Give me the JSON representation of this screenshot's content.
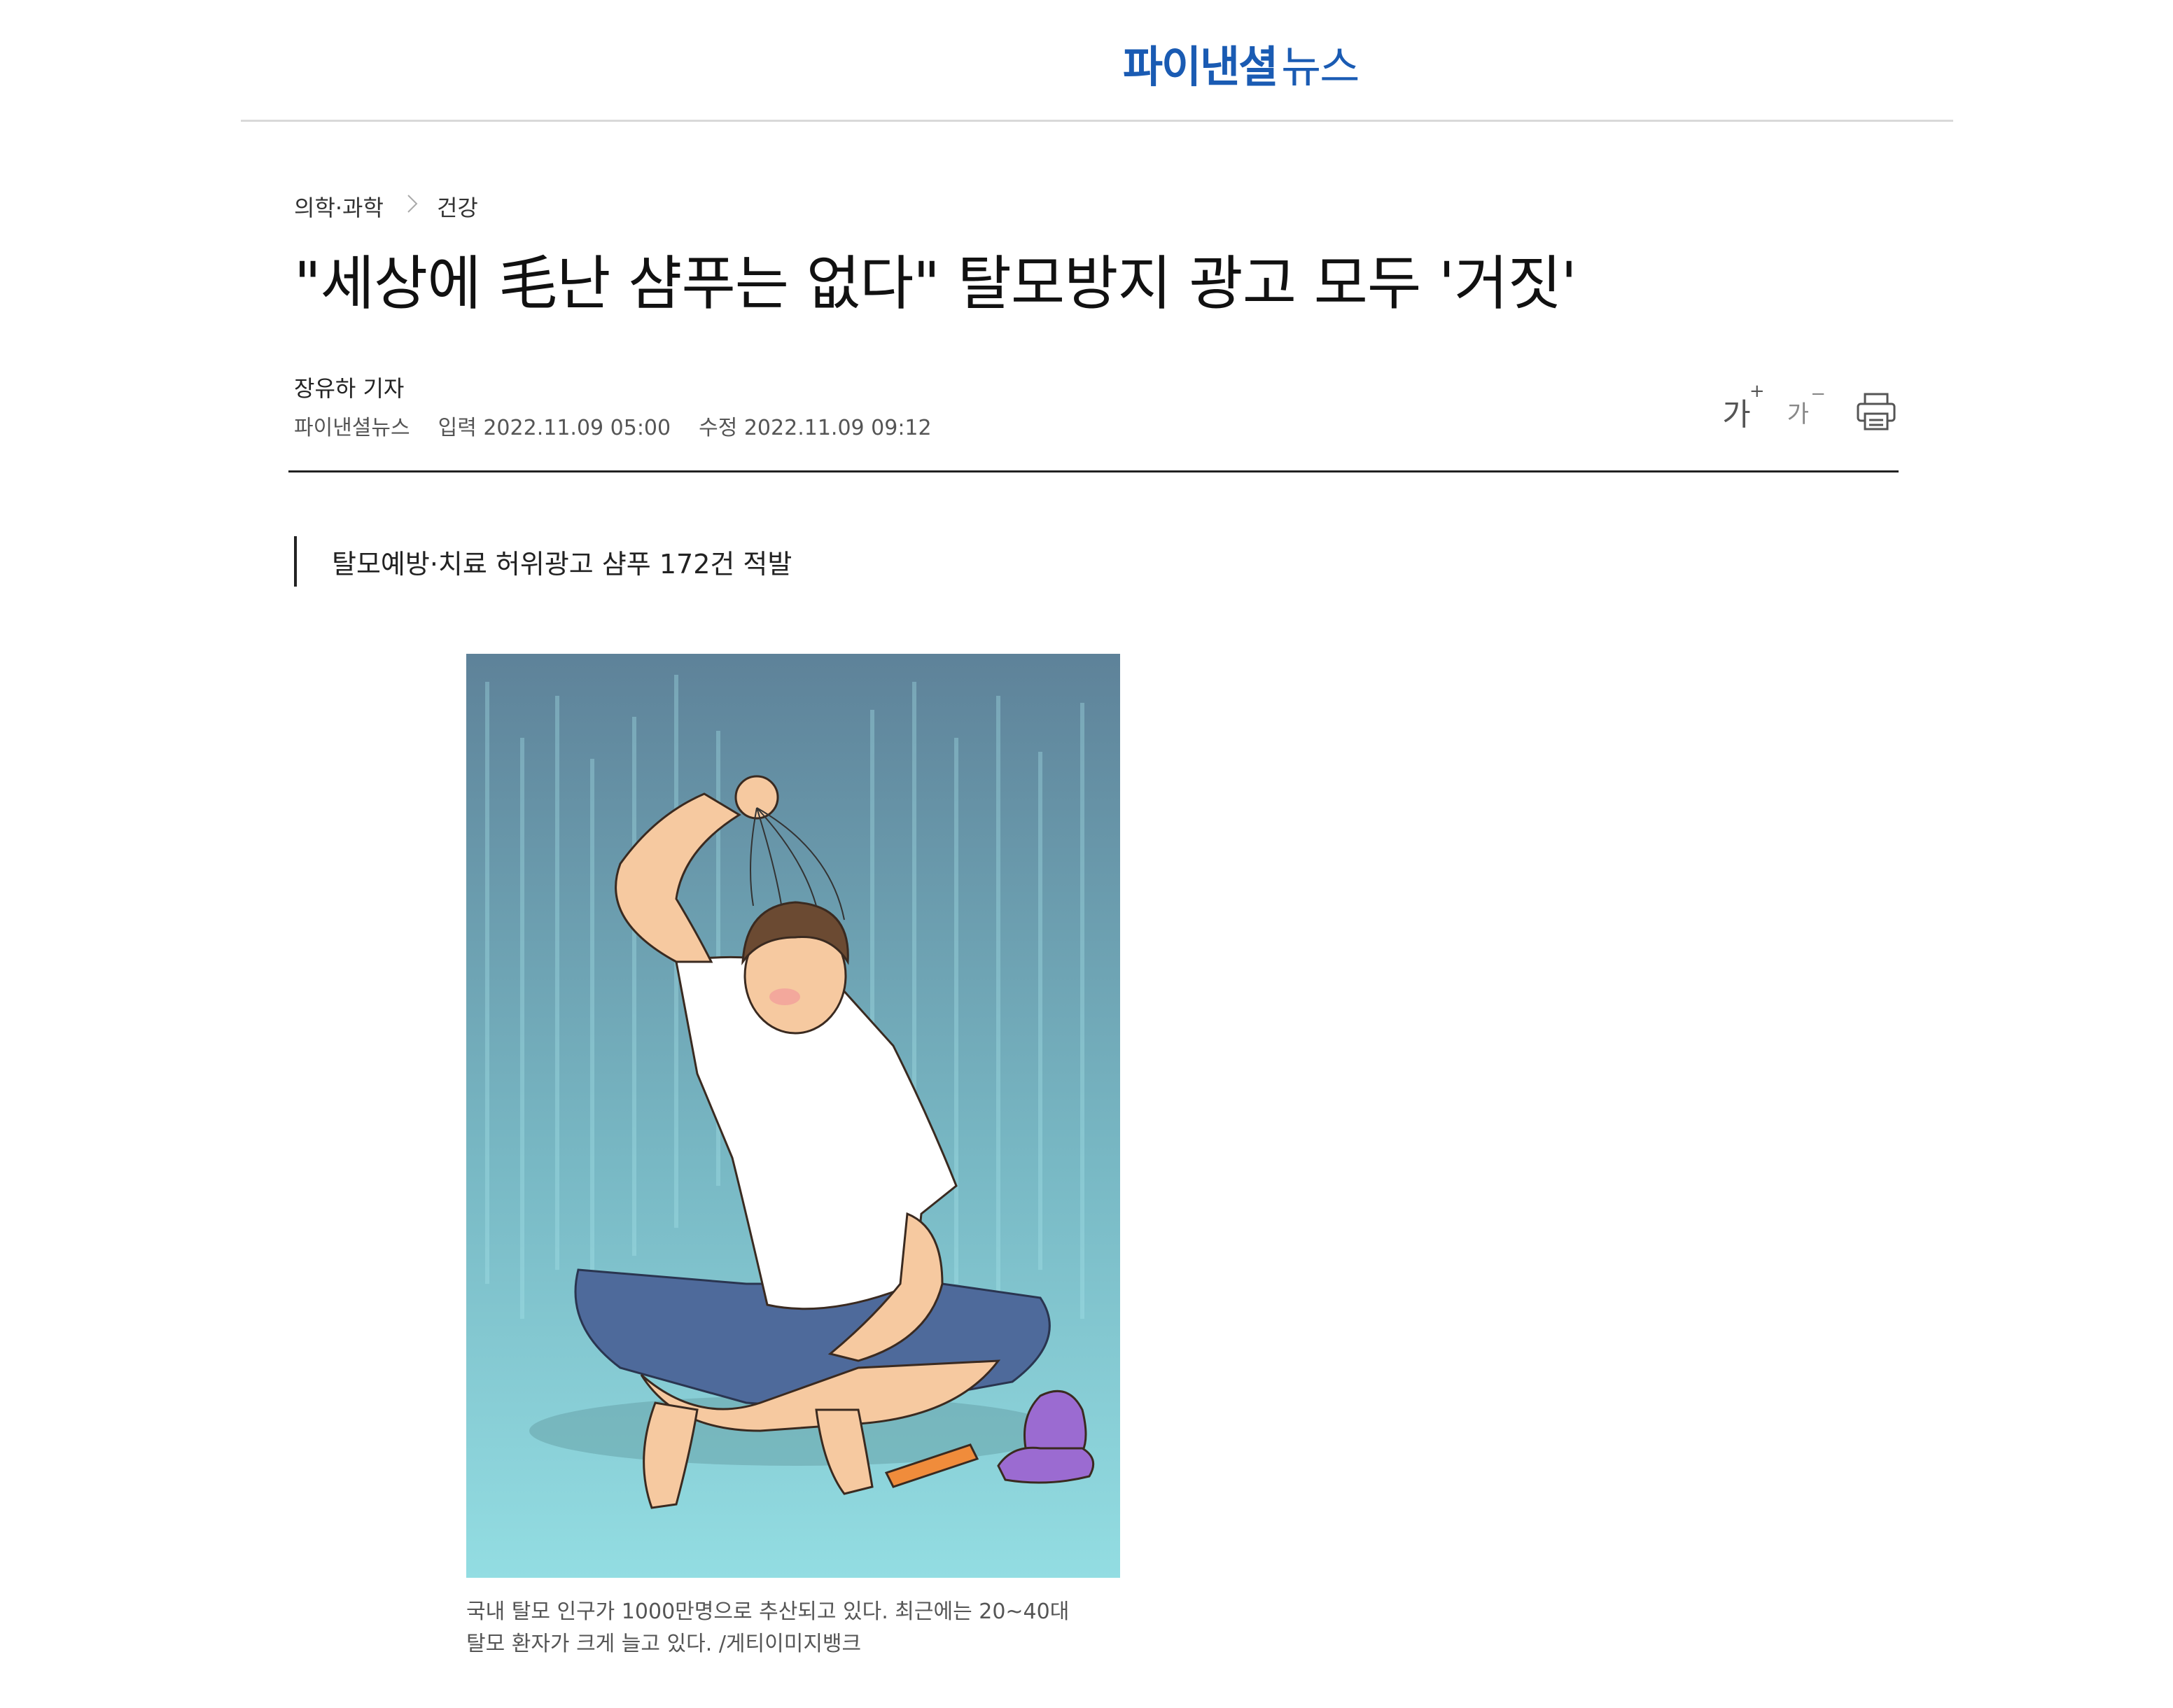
{
  "header": {
    "logo_bold": "파이낸셜",
    "logo_light": "뉴스"
  },
  "breadcrumb": {
    "section": "의학·과학",
    "subsection": "건강"
  },
  "article": {
    "headline": "\"세상에 毛난 샴푸는 없다\" 탈모방지 광고 모두 '거짓'",
    "reporter": "장유하 기자",
    "publisher": "파이낸셜뉴스",
    "published": "입력 2022.11.09 05:00",
    "modified": "수정 2022.11.09 09:12",
    "subheading": "탈모예방·치료 허위광고 샴푸 172건 적발",
    "caption_line1": "국내 탈모 인구가 1000만명으로 추산되고 있다. 최근에는 20~40대",
    "caption_line2": "탈모 환자가 크게 늘고 있다. /게티이미지뱅크"
  },
  "tools": {
    "font_increase": "가",
    "font_increase_sign": "+",
    "font_decrease": "가",
    "font_decrease_sign": "−",
    "print_icon": "printer-icon"
  },
  "colors": {
    "brand": "#1a5bb3",
    "image_top": "#5e8299",
    "image_bottom": "#93dde2"
  }
}
